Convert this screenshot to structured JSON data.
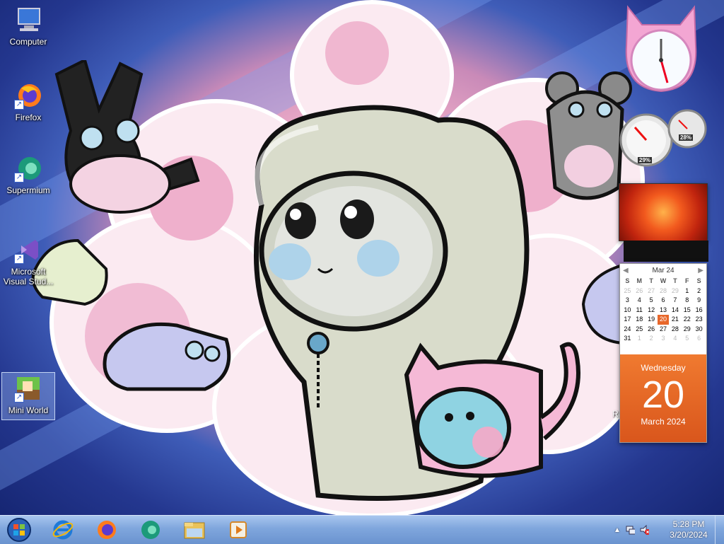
{
  "desktop": {
    "icons": [
      {
        "label": "Computer",
        "icon": "computer-icon"
      },
      {
        "label": "Firefox",
        "icon": "firefox-icon"
      },
      {
        "label": "Supermium",
        "icon": "supermium-icon"
      },
      {
        "label": "Microsoft Visual Stud...",
        "icon": "visual-studio-icon"
      },
      {
        "label": "Mini World",
        "icon": "mini-world-icon"
      }
    ]
  },
  "gadgets": {
    "cpu_meter": {
      "cpu_percent": "29%",
      "memory_percent": "28%"
    },
    "calendar": {
      "month_label": "Mar 24",
      "weekdays": [
        "S",
        "M",
        "T",
        "W",
        "T",
        "F",
        "S"
      ],
      "today_weekday": "Wednesday",
      "today_day": "20",
      "today_month_year": "March 2024"
    },
    "partial_text": "R"
  },
  "taskbar": {
    "pinned": [
      "start-orb-icon",
      "internet-explorer-icon",
      "firefox-icon",
      "supermium-icon",
      "file-explorer-icon",
      "media-player-icon"
    ],
    "clock_time": "5:28 PM",
    "clock_date": "3/20/2024"
  },
  "colors": {
    "accent": "#e8672a",
    "taskbar": "#7fa6dd"
  }
}
